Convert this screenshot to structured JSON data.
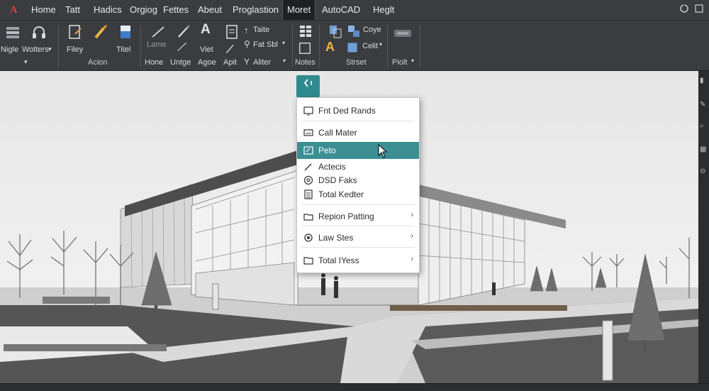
{
  "app": {
    "logo": "A"
  },
  "tabs": [
    {
      "label": "Home"
    },
    {
      "label": "Tatt"
    },
    {
      "label": "Hadics"
    },
    {
      "label": "Orgiog"
    },
    {
      "label": "Fettes"
    },
    {
      "label": "Abeut"
    },
    {
      "label": "Proglastion"
    },
    {
      "label": "Moret",
      "active": true
    },
    {
      "label": "AutoCAD"
    },
    {
      "label": "Heglt"
    }
  ],
  "ribbon": {
    "nigle": "Nigle",
    "wotters": "Wotters",
    "filey": "Filey",
    "titel": "Titel",
    "acion": "Acion",
    "lame": "Lame",
    "hone": "Hone",
    "untge": "Untge",
    "viet": "Viet",
    "agoe": "Agoe",
    "apit": "Apit",
    "taite": "Taite",
    "fatsrol": "Fat Sbl",
    "aliter": "Aliter",
    "notes": "Notes",
    "coye": "Coye",
    "celit": "Celit",
    "strset": "Strset",
    "piolt": "Piolt"
  },
  "menu": {
    "items": [
      {
        "label": "Fnt Ded Rands",
        "icon": "screen-icon"
      },
      {
        "label": "Call Mater",
        "icon": "keyboard-icon"
      },
      {
        "label": "Peto",
        "icon": "edit-box-icon",
        "highlighted": true
      },
      {
        "label": "Actecis",
        "icon": "pencil-icon"
      },
      {
        "label": "DSD Faks",
        "icon": "at-icon"
      },
      {
        "label": "Total Kedter",
        "icon": "calculator-icon"
      },
      {
        "label": "Repion Patting",
        "icon": "folder-export-icon",
        "submenu": true
      },
      {
        "label": "Law Stes",
        "icon": "gear-icon",
        "submenu": true
      },
      {
        "label": "Total IYess",
        "icon": "folder-icon",
        "submenu": true
      }
    ]
  },
  "colors": {
    "accent": "#3b8f93",
    "ribbon_bg": "#3a3c3f",
    "menu_bg": "#ffffff"
  }
}
